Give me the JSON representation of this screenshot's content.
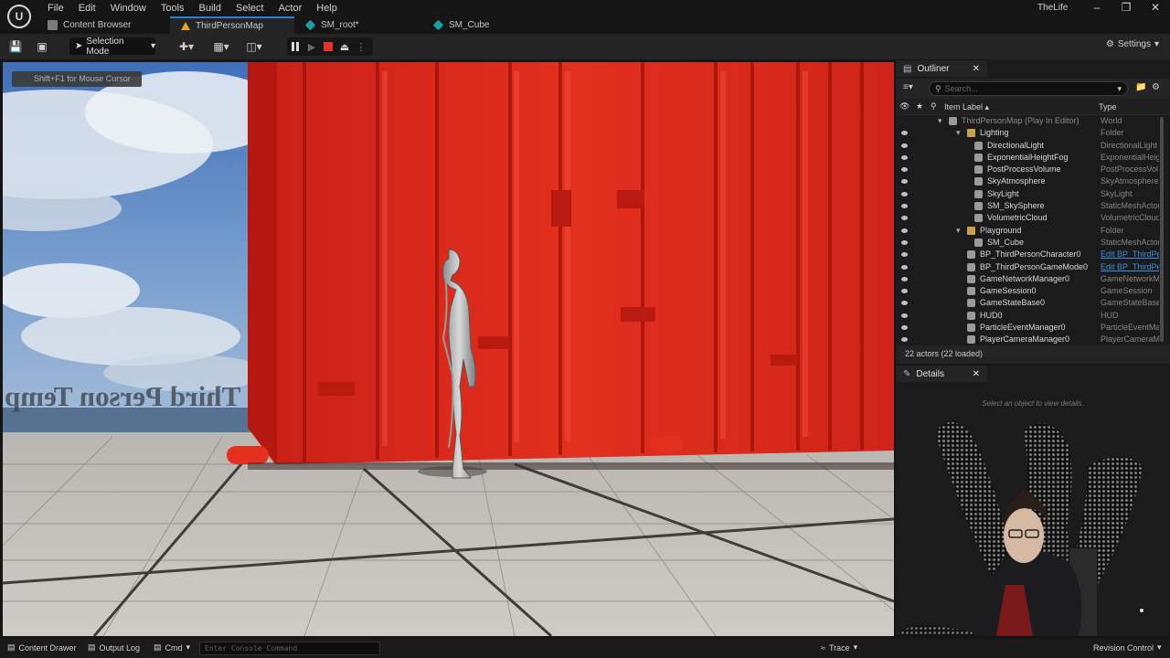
{
  "app": {
    "project_name": "TheLife",
    "menu": [
      "File",
      "Edit",
      "Window",
      "Tools",
      "Build",
      "Select",
      "Actor",
      "Help"
    ]
  },
  "tabs": [
    {
      "label": "Content Browser",
      "icon": "folder-icon"
    },
    {
      "label": "ThirdPersonMap",
      "icon": "map-icon",
      "active": true
    },
    {
      "label": "SM_root*",
      "icon": "static-mesh-icon"
    },
    {
      "label": "SM_Cube",
      "icon": "static-mesh-icon"
    }
  ],
  "toolbar": {
    "selection_mode": "Selection Mode",
    "settings": "Settings"
  },
  "viewport": {
    "hint": "Shift+F1 for Mouse Cursor",
    "mirrored_text": "Third Person Temp"
  },
  "outliner": {
    "title": "Outliner",
    "search_placeholder": "Search...",
    "col_label": "Item Label ▴",
    "col_type": "Type",
    "rows": [
      {
        "label": "ThirdPersonMap (Play In Editor)",
        "type": "World",
        "depth": 0,
        "kind": "world",
        "dim": true
      },
      {
        "label": "Lighting",
        "type": "Folder",
        "depth": 1,
        "kind": "folder"
      },
      {
        "label": "DirectionalLight",
        "type": "DirectionalLight",
        "depth": 2,
        "kind": "obj"
      },
      {
        "label": "ExponentialHeightFog",
        "type": "ExponentialHeig",
        "depth": 2,
        "kind": "obj"
      },
      {
        "label": "PostProcessVolume",
        "type": "PostProcessVol",
        "depth": 2,
        "kind": "obj"
      },
      {
        "label": "SkyAtmosphere",
        "type": "SkyAtmosphere",
        "depth": 2,
        "kind": "obj"
      },
      {
        "label": "SkyLight",
        "type": "SkyLight",
        "depth": 2,
        "kind": "obj"
      },
      {
        "label": "SM_SkySphere",
        "type": "StaticMeshActor",
        "depth": 2,
        "kind": "obj"
      },
      {
        "label": "VolumetricCloud",
        "type": "VolumetricCloud",
        "depth": 2,
        "kind": "obj"
      },
      {
        "label": "Playground",
        "type": "Folder",
        "depth": 1,
        "kind": "folder"
      },
      {
        "label": "SM_Cube",
        "type": "StaticMeshActor",
        "depth": 2,
        "kind": "obj"
      },
      {
        "label": "BP_ThirdPersonCharacter0",
        "type": "Edit BP_ThirdPe",
        "depth": 1,
        "kind": "obj",
        "link": true
      },
      {
        "label": "BP_ThirdPersonGameMode0",
        "type": "Edit BP_ThirdPe",
        "depth": 1,
        "kind": "obj",
        "link": true
      },
      {
        "label": "GameNetworkManager0",
        "type": "GameNetworkM",
        "depth": 1,
        "kind": "obj"
      },
      {
        "label": "GameSession0",
        "type": "GameSession",
        "depth": 1,
        "kind": "obj"
      },
      {
        "label": "GameStateBase0",
        "type": "GameStateBase",
        "depth": 1,
        "kind": "obj"
      },
      {
        "label": "HUD0",
        "type": "HUD",
        "depth": 1,
        "kind": "obj"
      },
      {
        "label": "ParticleEventManager0",
        "type": "ParticleEventMa",
        "depth": 1,
        "kind": "obj"
      },
      {
        "label": "PlayerCameraManager0",
        "type": "PlayerCameraM",
        "depth": 1,
        "kind": "obj"
      }
    ],
    "footer": "22 actors (22 loaded)"
  },
  "details": {
    "title": "Details",
    "empty_message": "Select an object to view details."
  },
  "bottombar": {
    "content_drawer": "Content Drawer",
    "output_log": "Output Log",
    "cmd": "Cmd",
    "console_placeholder": "Enter Console Command",
    "trace": "Trace",
    "revision_control": "Revision Control"
  },
  "colors": {
    "accent": "#2a7fd4",
    "wall_red": "#e02e22",
    "stop_red": "#e0342c",
    "link_blue": "#3d8fe0"
  }
}
